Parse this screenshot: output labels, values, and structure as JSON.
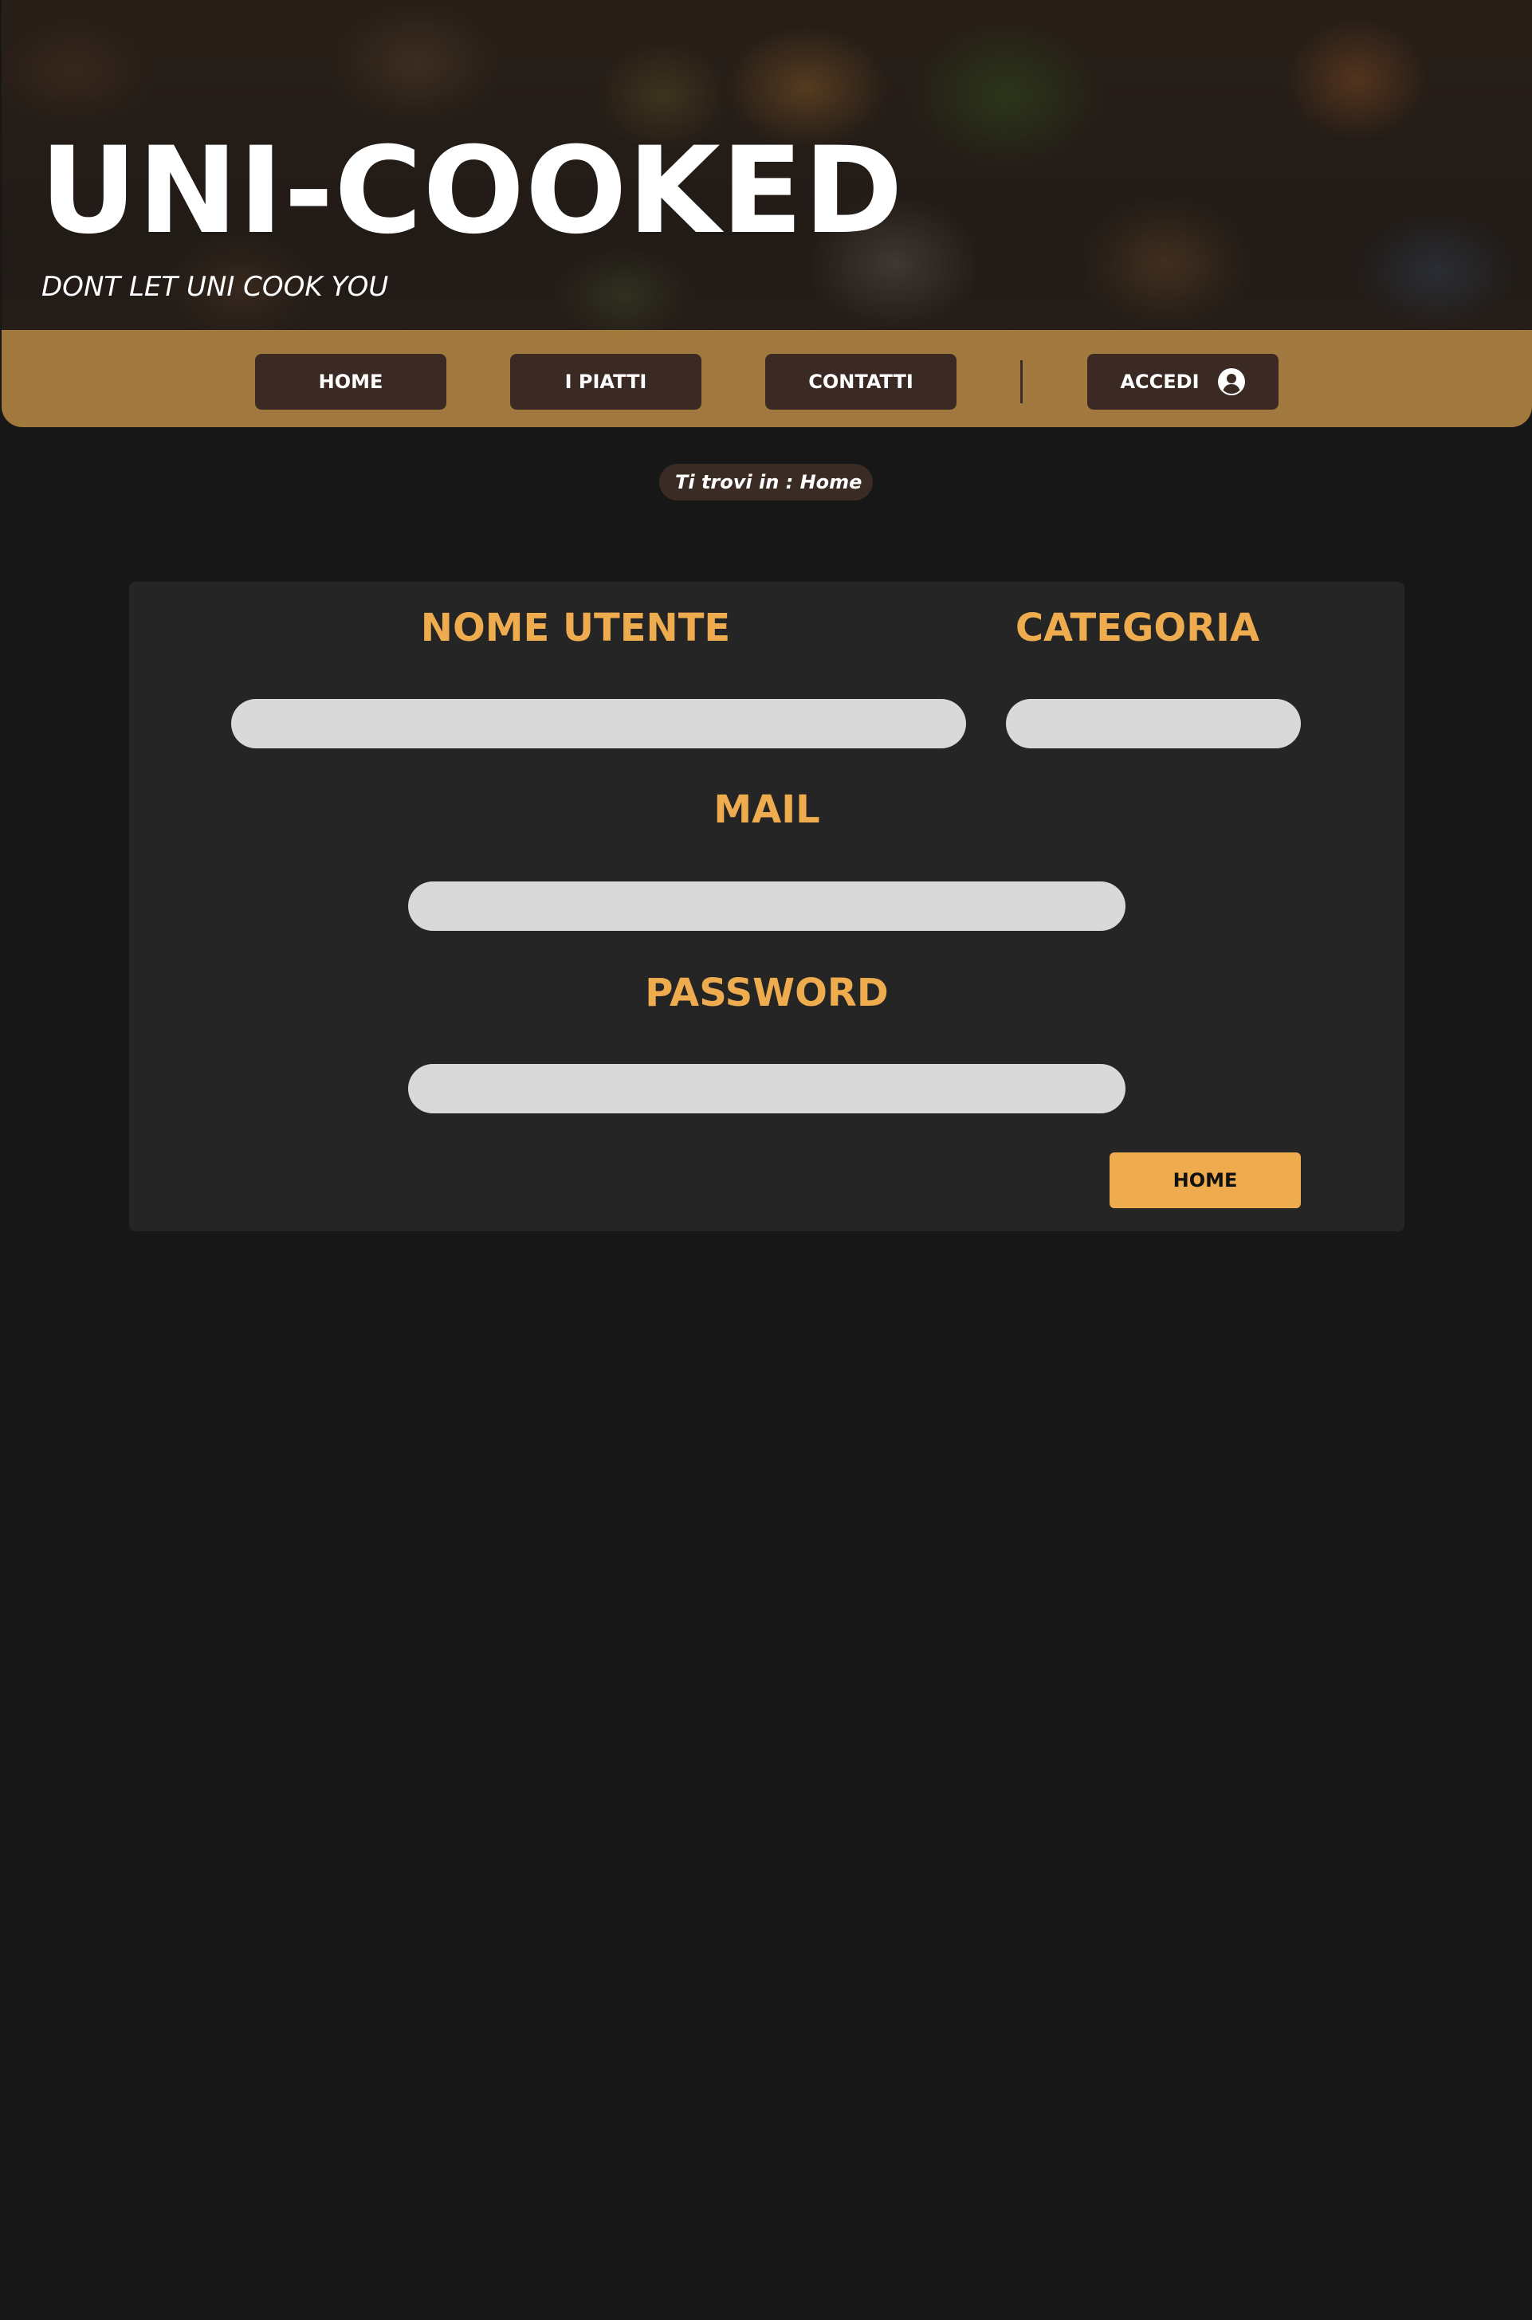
{
  "header": {
    "title": "UNI-COOKED",
    "tagline": "DONT LET UNI COOK YOU"
  },
  "nav": {
    "items": [
      {
        "label": "HOME"
      },
      {
        "label": "I PIATTI"
      },
      {
        "label": "CONTATTI"
      }
    ],
    "login": {
      "label": "ACCEDI",
      "icon": "user-circle-icon"
    }
  },
  "breadcrumb": {
    "text": "Ti trovi in : Home"
  },
  "form": {
    "username_label": "NOME UTENTE",
    "username_value": "",
    "category_label": "CATEGORIA",
    "category_value": "",
    "mail_label": "MAIL",
    "mail_value": "",
    "password_label": "PASSWORD",
    "password_value": "",
    "submit_label": "HOME"
  },
  "colors": {
    "background": "#171717",
    "panel": "#252525",
    "accent": "#eeac4f",
    "nav_button": "#3b2a24",
    "input": "#d9d9d9"
  }
}
